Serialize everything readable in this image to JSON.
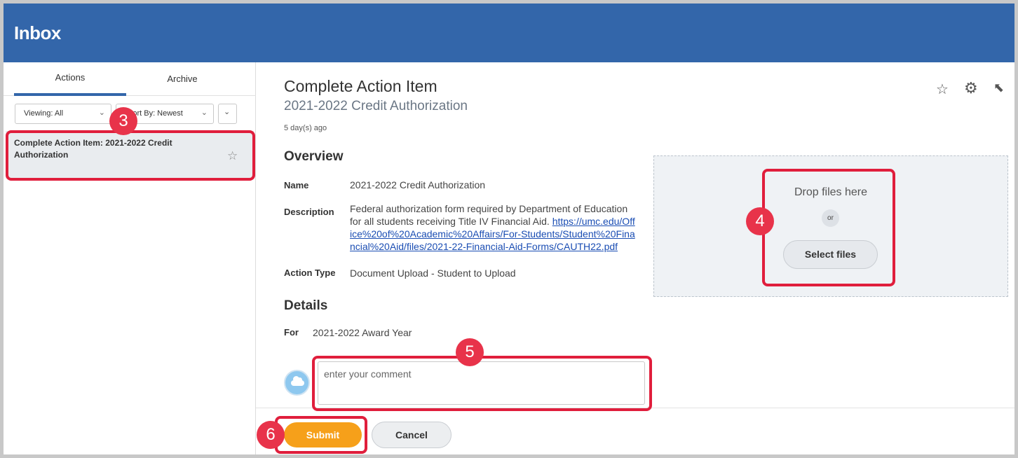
{
  "header": {
    "title": "Inbox"
  },
  "sidebar": {
    "tabs": [
      {
        "label": "Actions"
      },
      {
        "label": "Archive"
      }
    ],
    "viewing_label": "Viewing: All",
    "sort_label": "Sort By: Newest",
    "items": [
      {
        "title": "Complete Action Item: 2021-2022 Credit Authorization"
      }
    ]
  },
  "main": {
    "title": "Complete Action Item",
    "subtitle": "2021-2022 Credit Authorization",
    "age": "5 day(s) ago",
    "overview_heading": "Overview",
    "fields": {
      "name_label": "Name",
      "name_value": "2021-2022 Credit Authorization",
      "description_label": "Description",
      "description_text": "Federal authorization form required by Department of Education for all students receiving Title IV Financial Aid. ",
      "description_link": "https://umc.edu/Office%20of%20Academic%20Affairs/For-Students/Student%20Financial%20Aid/files/2021-22-Financial-Aid-Forms/CAUTH22.pdf",
      "action_type_label": "Action Type",
      "action_type_value": "Document Upload - Student to Upload"
    },
    "details_heading": "Details",
    "for_label": "For",
    "for_value": "2021-2022 Award Year",
    "comment_placeholder": "enter your comment"
  },
  "upload": {
    "drop_text": "Drop files here",
    "or_text": "or",
    "select_files_label": "Select files"
  },
  "footer": {
    "submit_label": "Submit",
    "cancel_label": "Cancel"
  },
  "callouts": [
    "3",
    "4",
    "5",
    "6"
  ],
  "colors": {
    "header_bg": "#3366aa",
    "submit_bg": "#f6a01a",
    "callout": "#e01e3c"
  },
  "icons": {
    "star": "star-outline-icon",
    "gear": "gear-icon",
    "expand": "expand-icon",
    "chevron": "chevron-down-icon",
    "avatar": "cloud-avatar-icon"
  }
}
